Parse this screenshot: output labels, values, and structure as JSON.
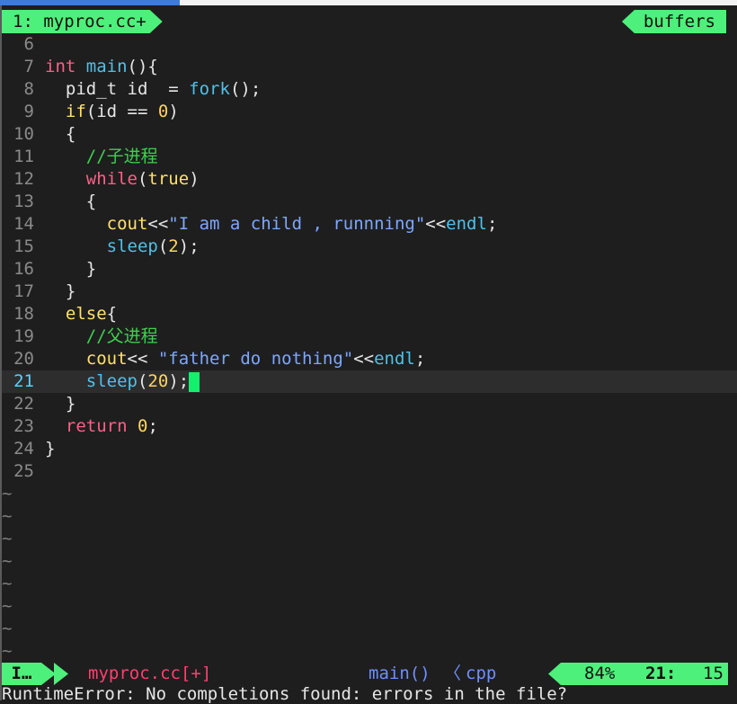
{
  "tabline": {
    "active_tab": "1: myproc.cc+",
    "buffers_label": "buffers"
  },
  "lines": [
    {
      "n": "6"
    },
    {
      "n": "7"
    },
    {
      "n": "8"
    },
    {
      "n": "9"
    },
    {
      "n": "10"
    },
    {
      "n": "11"
    },
    {
      "n": "12"
    },
    {
      "n": "13"
    },
    {
      "n": "14"
    },
    {
      "n": "15"
    },
    {
      "n": "16"
    },
    {
      "n": "17"
    },
    {
      "n": "18"
    },
    {
      "n": "19"
    },
    {
      "n": "20"
    },
    {
      "n": "21"
    },
    {
      "n": "22"
    },
    {
      "n": "23"
    },
    {
      "n": "24"
    },
    {
      "n": "25"
    }
  ],
  "code": {
    "l7_type": "int",
    "l7_fn": "main",
    "l7_rest": "(){",
    "l8_a": "pid_t id  = ",
    "l8_fn": "fork",
    "l8_rest": "();",
    "l9_kw": "if",
    "l9_a": "(id == ",
    "l9_num": "0",
    "l9_rest": ")",
    "l10": "{",
    "l11_cmt": "//子进程",
    "l12_kw": "while",
    "l12_a": "(",
    "l12_true": "true",
    "l12_b": ")",
    "l13": "{",
    "l14_id": "cout",
    "l14_a": "<<",
    "l14_str": "\"I am a child , runnning\"",
    "l14_b": "<<",
    "l14_fn": "endl",
    "l14_c": ";",
    "l15_fn": "sleep",
    "l15_a": "(",
    "l15_num": "2",
    "l15_b": ");",
    "l16": "}",
    "l17": "}",
    "l18_kw": "else",
    "l18_a": "{",
    "l19_cmt": "//父进程",
    "l20_id": "cout",
    "l20_a": "<< ",
    "l20_str": "\"father do nothing\"",
    "l20_b": "<<",
    "l20_fn": "endl",
    "l20_c": ";",
    "l21_fn": "sleep",
    "l21_a": "(",
    "l21_num": "20",
    "l21_b": ");",
    "l22": "}",
    "l23_kw": "return",
    "l23_sp": " ",
    "l23_num": "0",
    "l23_c": ";",
    "l24": "}"
  },
  "tilde": "~",
  "status": {
    "mode": "I…",
    "filename": "myproc.cc[+]",
    "function": "main()",
    "separator": "〈",
    "filetype": "cpp",
    "percent": "84%",
    "line": "21:",
    "column": "15"
  },
  "message": "RuntimeError: No completions found: errors in the file?",
  "colors": {
    "accent_green": "#4df07b",
    "keyword": "#ff5f87",
    "function": "#4fc1e9",
    "number": "#ffd45f",
    "comment": "#3fcf4f",
    "string": "#7ea7ff"
  }
}
